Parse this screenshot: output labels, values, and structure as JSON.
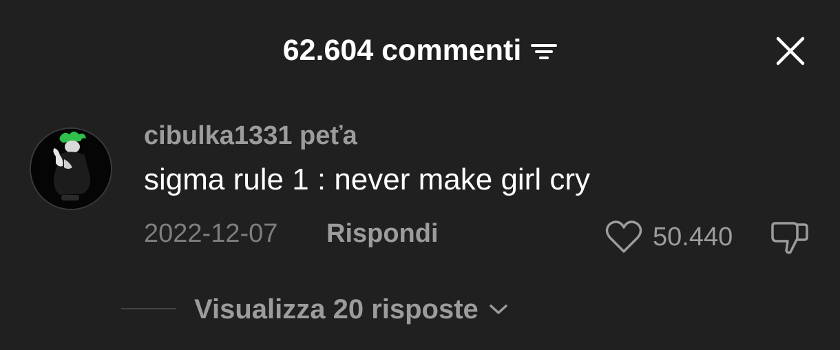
{
  "header": {
    "title": "62.604 commenti",
    "filter_icon": "filter-icon",
    "close_icon": "close-icon"
  },
  "comment": {
    "avatar_icon": "avatar",
    "username": "cibulka1331 peťa",
    "text": "sigma rule 1 : never make girl cry",
    "date": "2022-12-07",
    "reply_label": "Rispondi",
    "like_count": "50.440",
    "like_icon": "heart-icon",
    "dislike_icon": "thumbs-down-icon",
    "view_replies_label": "Visualizza 20 risposte"
  },
  "colors": {
    "background": "#202020",
    "primary_text": "#ffffff",
    "secondary_text": "#9c9c9c",
    "muted_text": "#7e7e7e"
  }
}
